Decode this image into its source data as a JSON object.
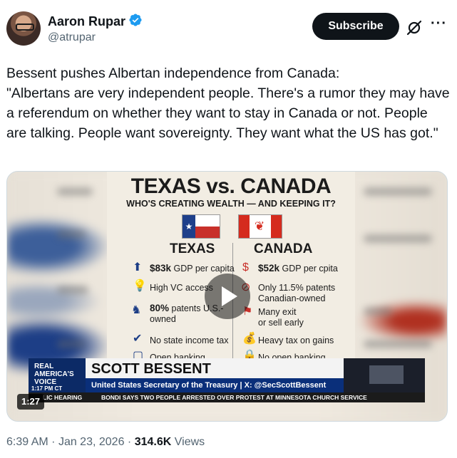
{
  "author": {
    "name": "Aaron Rupar",
    "handle": "@atrupar",
    "verified_color": "#1d9bf0"
  },
  "actions": {
    "subscribe_label": "Subscribe",
    "grok_icon": "grok-slash-icon",
    "more_label": "···"
  },
  "tweet": {
    "text": "Bessent pushes Albertan independence from Canada:\n\"Albertans are very independent people. There's a rumor they may have a referendum on whether they want to stay in Canada or not. People are talking. People want sovereignty. They want what the US has got.\""
  },
  "video": {
    "duration": "1:27",
    "graphic": {
      "title": "TEXAS vs. CANADA",
      "subtitle": "WHO'S CREATING WEALTH — AND KEEPING IT?",
      "left_header": "TEXAS",
      "right_header": "CANADA",
      "left_rows": [
        {
          "bold": "$83k",
          "text": " GDP per capita"
        },
        {
          "bold": "",
          "text": "High VC access"
        },
        {
          "bold": "80%",
          "text": " patents U.S.-\nowned"
        },
        {
          "bold": "",
          "text": "No state income tax"
        },
        {
          "bold": "",
          "text": "Open banking"
        }
      ],
      "right_rows": [
        {
          "bold": "$52k",
          "text": " GDP per cpita"
        },
        {
          "bold": "",
          "text": "Only 11.5% patents\nCanadian-owned"
        },
        {
          "bold": "",
          "text": "Many exit\nor sell early"
        },
        {
          "bold": "",
          "text": "Heavy tax on gains"
        },
        {
          "bold": "",
          "text": "No open banking"
        }
      ]
    },
    "chyron": {
      "network": "REAL AMERICA'S VOICE",
      "time": "1:17 PM CT",
      "name": "SCOTT BESSENT",
      "title": "United States Secretary of the Treasury | X: @SecScottBessent",
      "ticker_left": "LIC HEARING",
      "ticker_right": "BONDI SAYS TWO PEOPLE ARRESTED OVER PROTEST AT MINNESOTA CHURCH SERVICE"
    }
  },
  "meta": {
    "time": "6:39 AM",
    "date": "Jan 23, 2026",
    "views_count": "314.6K",
    "views_label": "Views"
  }
}
